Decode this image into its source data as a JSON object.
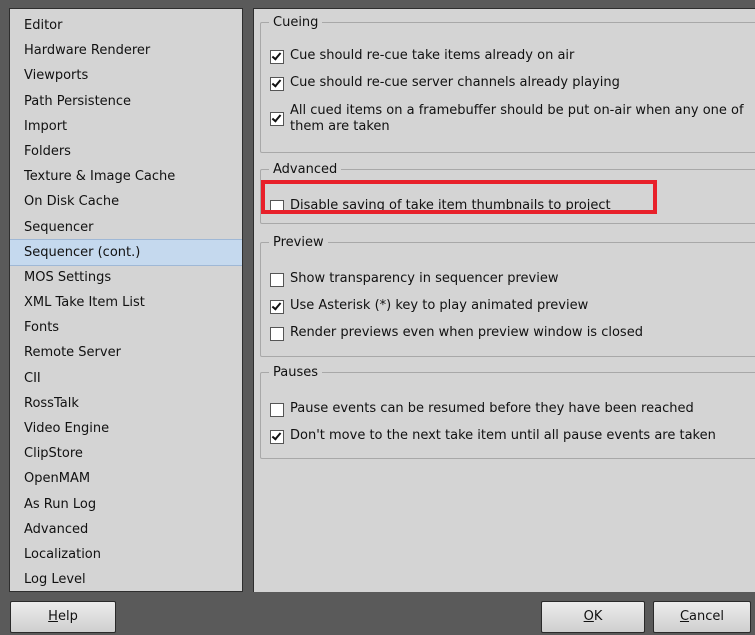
{
  "sidebar": {
    "items": [
      {
        "label": "Editor"
      },
      {
        "label": "Hardware Renderer"
      },
      {
        "label": "Viewports"
      },
      {
        "label": "Path Persistence"
      },
      {
        "label": "Import"
      },
      {
        "label": "Folders"
      },
      {
        "label": "Texture & Image Cache"
      },
      {
        "label": "On Disk Cache"
      },
      {
        "label": "Sequencer"
      },
      {
        "label": "Sequencer (cont.)",
        "selected": true
      },
      {
        "label": "MOS Settings"
      },
      {
        "label": "XML Take Item List"
      },
      {
        "label": "Fonts"
      },
      {
        "label": "Remote Server"
      },
      {
        "label": "CII"
      },
      {
        "label": "RossTalk"
      },
      {
        "label": "Video Engine"
      },
      {
        "label": "ClipStore"
      },
      {
        "label": "OpenMAM"
      },
      {
        "label": "As Run Log"
      },
      {
        "label": "Advanced"
      },
      {
        "label": "Localization"
      },
      {
        "label": "Log Level"
      }
    ]
  },
  "groups": {
    "cueing": {
      "title": "Cueing",
      "options": [
        {
          "label": "Cue should re-cue take items already on air",
          "checked": true
        },
        {
          "label": "Cue should re-cue server channels already playing",
          "checked": true
        },
        {
          "label": "All cued items on a framebuffer should be put on-air when any one of them are taken",
          "checked": true
        }
      ]
    },
    "advanced": {
      "title": "Advanced",
      "options": [
        {
          "label": "Disable saving of take item thumbnails to project",
          "checked": false
        }
      ]
    },
    "preview": {
      "title": "Preview",
      "options": [
        {
          "label": "Show transparency in sequencer preview",
          "checked": false
        },
        {
          "label": "Use Asterisk (*) key to play animated preview",
          "checked": true
        },
        {
          "label": "Render previews even when preview window is closed",
          "checked": false
        }
      ]
    },
    "pauses": {
      "title": "Pauses",
      "options": [
        {
          "label": "Pause events can be resumed before they have been reached",
          "checked": false
        },
        {
          "label": "Don't move to the next take item until all pause events are taken",
          "checked": true
        }
      ]
    }
  },
  "footer": {
    "help": {
      "mnemonic": "H",
      "rest": "elp"
    },
    "ok": {
      "mnemonic": "O",
      "rest": "K"
    },
    "cancel": {
      "mnemonic": "C",
      "rest": "ancel"
    }
  },
  "colors": {
    "background": "#5a5a5a",
    "panel": "#d4d4d4",
    "selection": "#c5d9ee",
    "highlight_box": "#e8202a"
  }
}
